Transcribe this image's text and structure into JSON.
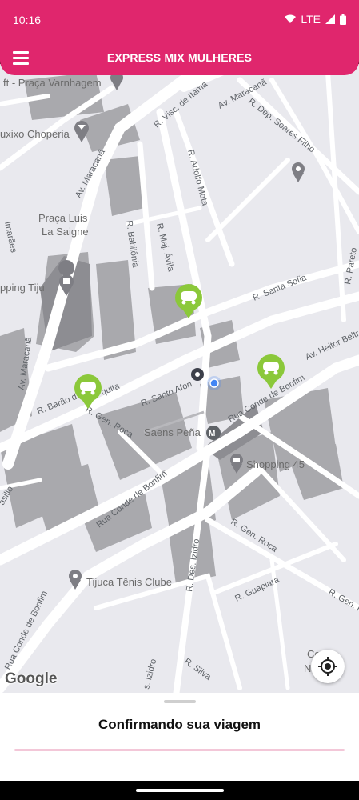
{
  "status_bar": {
    "time": "10:16",
    "network": "LTE"
  },
  "app_bar": {
    "title": "EXPRESS MIX MULHERES",
    "menu_icon": "hamburger-menu-icon"
  },
  "map": {
    "places": {
      "praca_varnhagem": "Praça Varnhagem",
      "chopperia": "uxixo Choperia",
      "praca_luis": "Praça Luis",
      "la_saigne": "La Saigne",
      "shopping_tijuca": "pping Tiju",
      "saens_pena": "Saens Peña",
      "shopping_45": "Shopping 45",
      "tijuca_tenis": "Tijuca Tênis Clube",
      "colegio": "Co",
      "colegio2": "N"
    },
    "streets": {
      "maracana1": "Av. Maracanã",
      "maracana2": "Av. Maracanã",
      "maracana3": "Av. Maracanã",
      "visc_itama": "R. Visc. de Itama",
      "dep_soares": "R. Dep. Soares Filho",
      "adolfo_mota": "R. Adolfo Mota",
      "babilonia": "R. Babilônia",
      "maj_avila": "R. Maj. Ávila",
      "santa_sofia": "R. Santa Sofia",
      "heitor_beltrao": "Av. Heitor Beltr",
      "barao": "R. Barão d",
      "quita": "quita",
      "gen_roca": "R. Gen. Roca",
      "santo_afonso": "R. Santo Afon",
      "conde_bonfim1": "Rua Conde de Bonfim",
      "conde_bonfim2": "Rua Conde de Bonfim",
      "conde_bonfim3": "Rua Conde de Bonfim",
      "des_izidro": "R. Des. Izidro",
      "gen_roca2": "R. Gen. Roca",
      "guapiara": "R. Guapiara",
      "silva": "R. Silva",
      "izidro2": "s. Izidro",
      "basilio": "asilio",
      "imaraes": "imarães",
      "pareto": "R. Pareto",
      "gen_r": "R. Gen. R"
    }
  },
  "attribution": "Google",
  "sheet": {
    "title": "Confirmando sua viagem",
    "progress": 0.0
  },
  "colors": {
    "brand": "#e0266d",
    "car_marker": "#8bc83a"
  }
}
